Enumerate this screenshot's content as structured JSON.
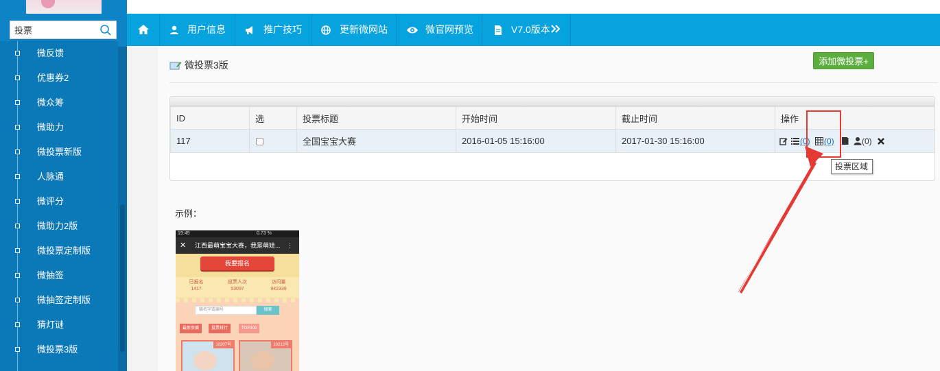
{
  "sidebar": {
    "search": {
      "value": "投票",
      "placeholder": ""
    },
    "items": [
      {
        "label": "微反馈"
      },
      {
        "label": "优惠券2"
      },
      {
        "label": "微众筹"
      },
      {
        "label": "微助力"
      },
      {
        "label": "微投票新版"
      },
      {
        "label": "人脉通"
      },
      {
        "label": "微评分"
      },
      {
        "label": "微助力2版"
      },
      {
        "label": "微投票定制版"
      },
      {
        "label": "微抽签"
      },
      {
        "label": "微抽签定制版"
      },
      {
        "label": "猜灯谜"
      },
      {
        "label": "微投票3版"
      }
    ]
  },
  "topnav": {
    "items": [
      {
        "label": "用户信息",
        "icon": "user-icon"
      },
      {
        "label": "推广技巧",
        "icon": "megaphone-icon"
      },
      {
        "label": "更新微网站",
        "icon": "globe-icon"
      },
      {
        "label": "微官网预览",
        "icon": "eye-icon"
      },
      {
        "label": "V7.0版本",
        "icon": "document-icon"
      }
    ]
  },
  "page": {
    "title": "微投票3版",
    "add_button": "添加微投票+",
    "example_label": "示例："
  },
  "table": {
    "headers": [
      "ID",
      "选",
      "投票标题",
      "开始时间",
      "截止时间",
      "操作"
    ],
    "rows": [
      {
        "id": "117",
        "title": "全国宝宝大赛",
        "start": "2016-01-05 15:16:00",
        "end": "2017-01-30 15:16:00",
        "list_count": "(0)",
        "area_count": "(0)",
        "user_count": "(0)"
      }
    ]
  },
  "tooltip": "投票区域",
  "phone": {
    "time": "19:49",
    "status_right": "0.73 %",
    "title": "江西最萌宝宝大赛，我是萌娃...",
    "signup": "我要报名",
    "stats": [
      {
        "label": "已报名",
        "value": "1417"
      },
      {
        "label": "投票人次",
        "value": "53097"
      },
      {
        "label": "访问量",
        "value": "942339"
      }
    ],
    "search_placeholder": "输名字或编号",
    "search_button": "搜索",
    "tabs": [
      "最新参赛",
      "投票排行",
      "TOP300"
    ],
    "cards": [
      "10207号",
      "10212号"
    ]
  },
  "colors": {
    "sidebar": "#0e84c6",
    "topnav": "#07a3de",
    "add_button": "#5cae3f",
    "highlight": "#e53935"
  }
}
